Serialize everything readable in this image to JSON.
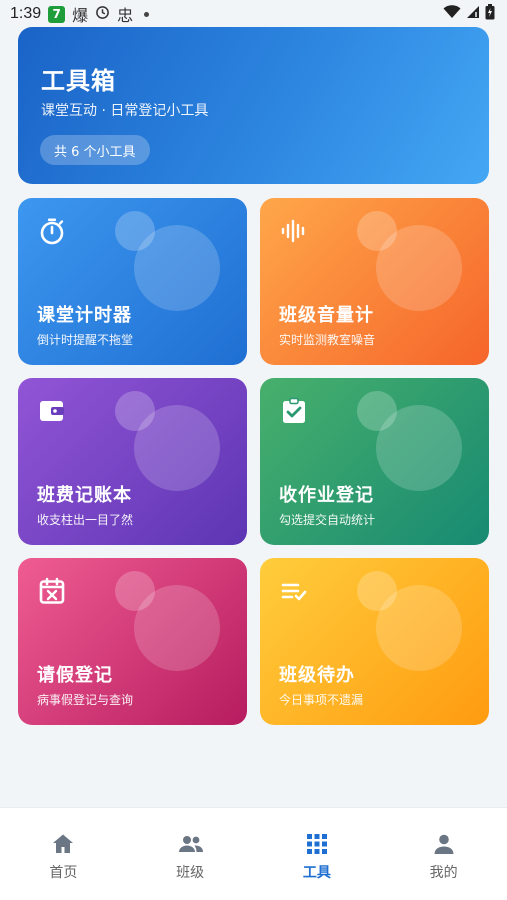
{
  "status_bar": {
    "time": "1:39",
    "badge": "7",
    "glyph_a": "爆",
    "glyph_b": "忠"
  },
  "banner": {
    "title": "工具箱",
    "subtitle": "课堂互动 · 日常登记小工具",
    "count_pill": "共 6 个小工具"
  },
  "tools": [
    {
      "title": "课堂计时器",
      "subtitle": "倒计时提醒不拖堂",
      "icon": "stopwatch-icon"
    },
    {
      "title": "班级音量计",
      "subtitle": "实时监测教室噪音",
      "icon": "sound-wave-icon"
    },
    {
      "title": "班费记账本",
      "subtitle": "收支柱出一目了然",
      "icon": "wallet-icon"
    },
    {
      "title": "收作业登记",
      "subtitle": "勾选提交自动统计",
      "icon": "clipboard-check-icon"
    },
    {
      "title": "请假登记",
      "subtitle": "病事假登记与查询",
      "icon": "calendar-cancel-icon"
    },
    {
      "title": "班级待办",
      "subtitle": "今日事项不遗漏",
      "icon": "checklist-icon"
    }
  ],
  "nav": {
    "items": [
      {
        "label": "首页",
        "icon": "home-icon"
      },
      {
        "label": "班级",
        "icon": "people-icon"
      },
      {
        "label": "工具",
        "icon": "grid-icon"
      },
      {
        "label": "我的",
        "icon": "person-icon"
      }
    ],
    "active_index": 2
  },
  "colors": {
    "accent": "#1f6fd2",
    "timer": "#2a7fe0",
    "volume": "#f8823a",
    "ledger": "#7545c6",
    "homework": "#2e9d6e",
    "leave": "#d83c79",
    "todo": "#ffb423"
  }
}
